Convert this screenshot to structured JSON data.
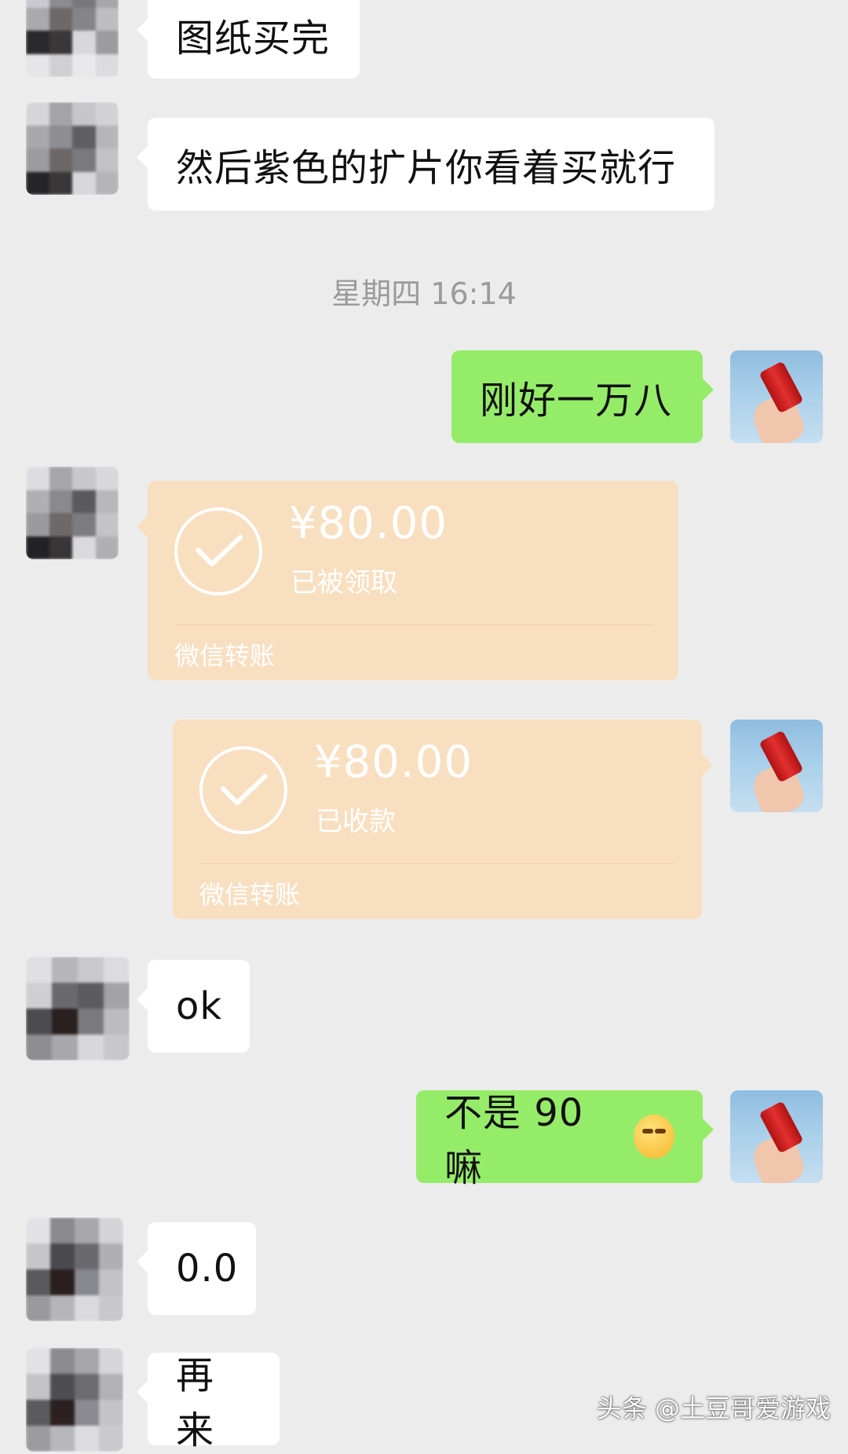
{
  "messages": {
    "m1": "图纸买完",
    "m2": "然后紫色的扩片你看着买就行",
    "timestamp": "星期四 16:14",
    "m3": "刚好一万八",
    "transfer1": {
      "amount": "¥80.00",
      "status": "已被领取",
      "footer": "微信转账"
    },
    "transfer2": {
      "amount": "¥80.00",
      "status": "已收款",
      "footer": "微信转账"
    },
    "m4": "ok",
    "m5": "不是 90 嘛",
    "m5_emoji": "facepalm-laughing-emoji",
    "m6": "0.0",
    "m7": "再来"
  },
  "watermark": "头条 @土豆哥爱游戏",
  "colors": {
    "background": "#ececec",
    "sent_bubble": "#95ec69",
    "received_bubble": "#ffffff",
    "transfer_card": "#f8dfc0"
  }
}
